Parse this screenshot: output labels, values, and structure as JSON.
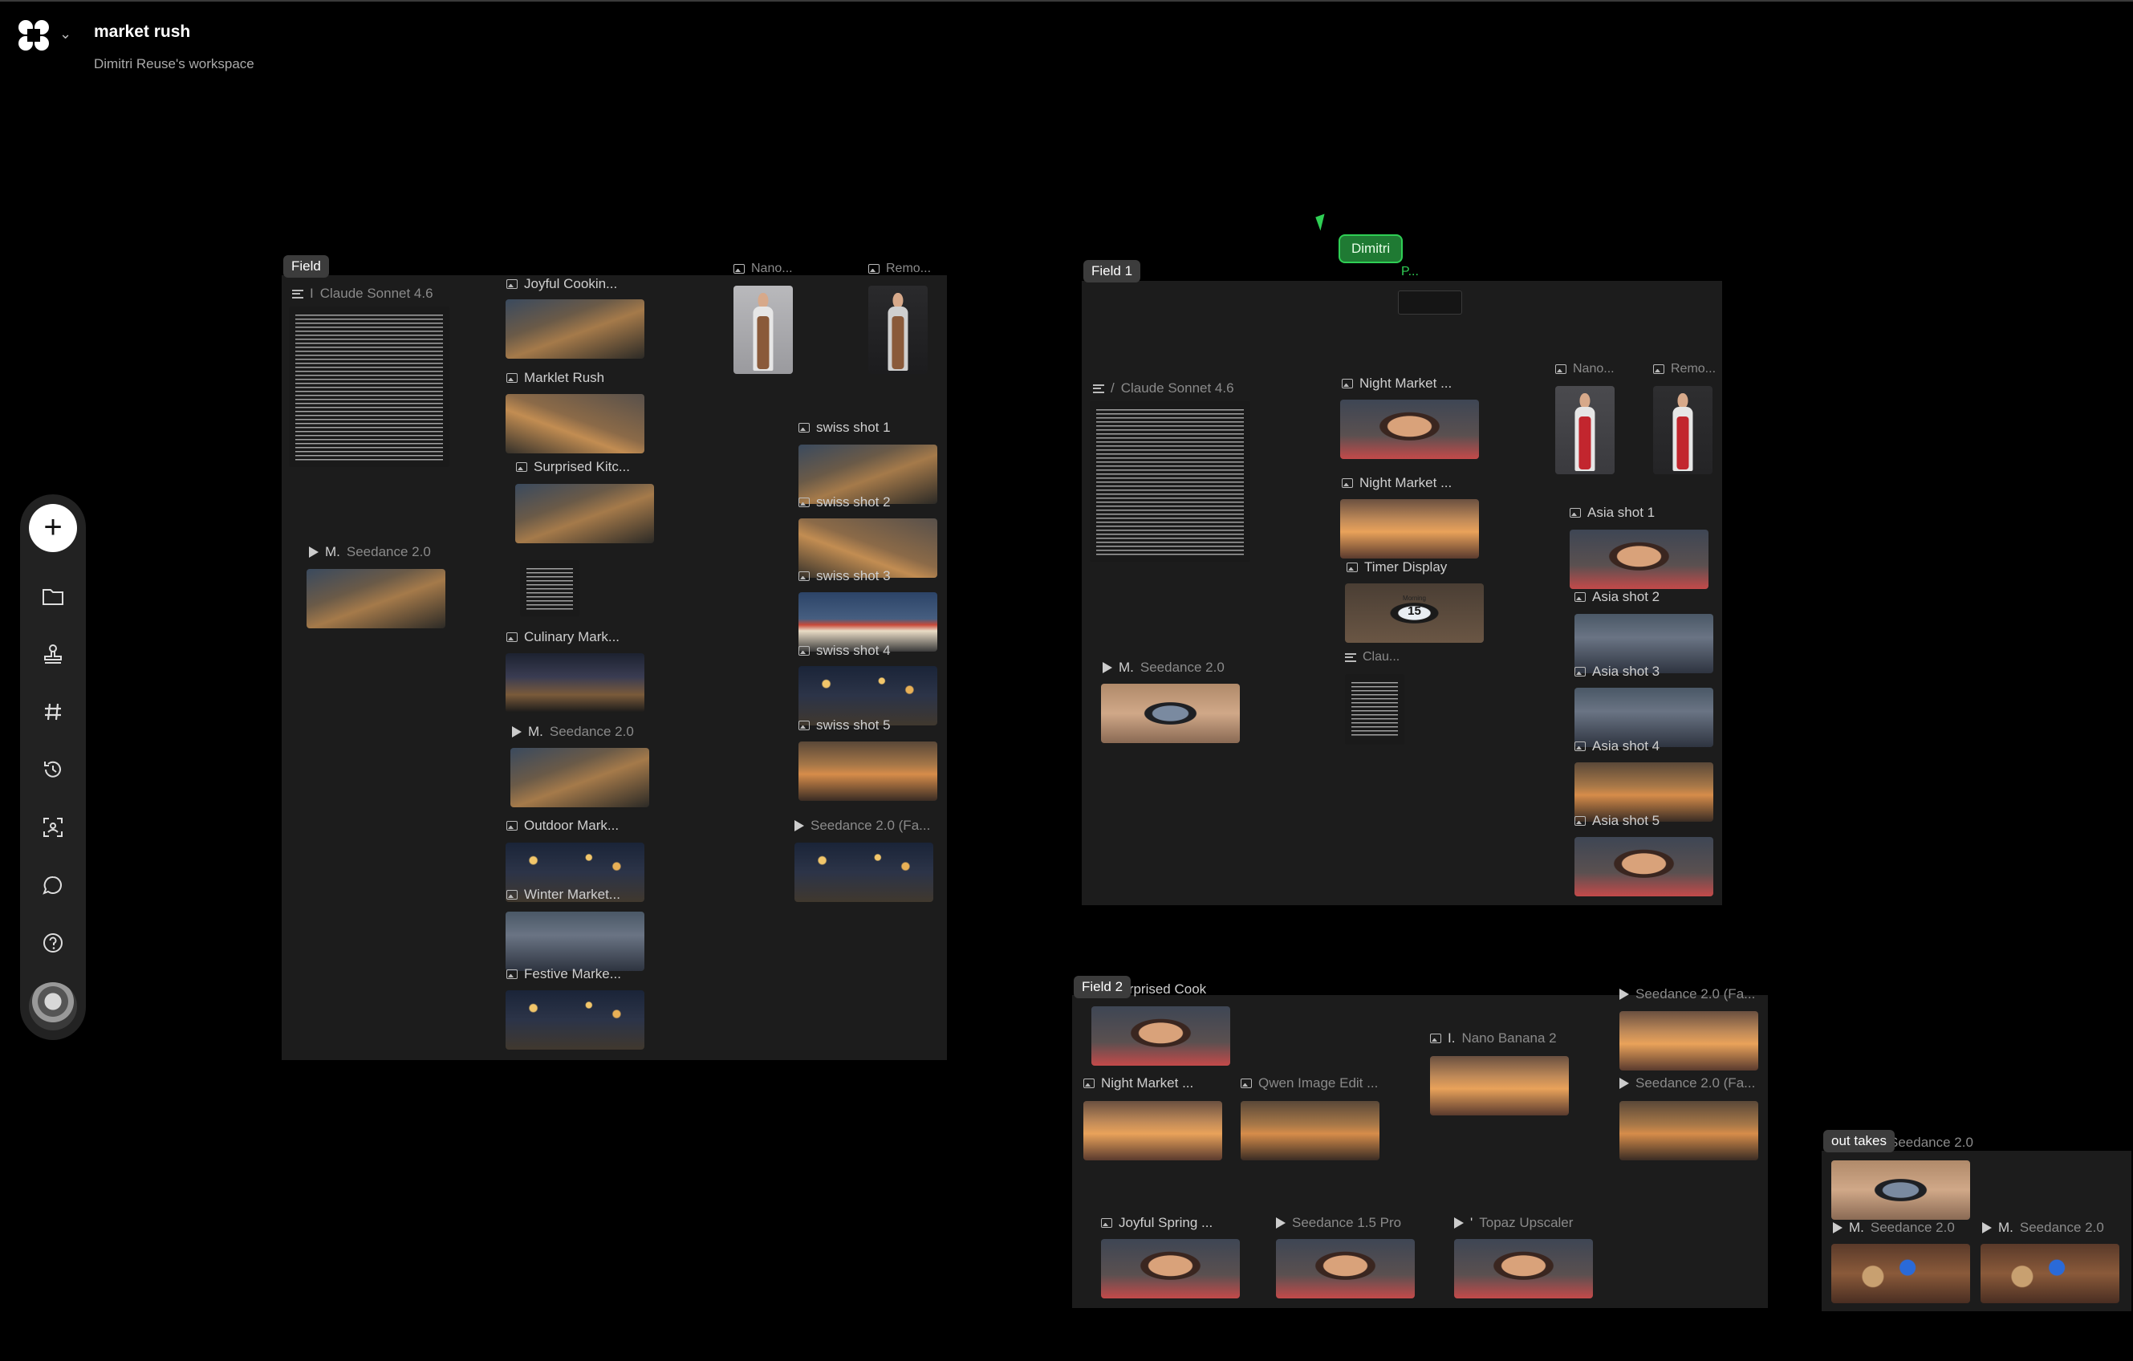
{
  "workspace": {
    "title": "market rush",
    "subtitle": "Dimitri Reuse's workspace"
  },
  "toolbar": {
    "items": [
      "add",
      "folder-icon",
      "stamp-icon",
      "hash-icon",
      "history-icon",
      "scan-icon",
      "chat-icon",
      "help-icon"
    ]
  },
  "collaborator": {
    "name": "Dimitri",
    "mini_label": "P..."
  },
  "field0": {
    "label": "Field",
    "nodes": {
      "claude": "Claude Sonnet 4.6",
      "claude_prefix": "I",
      "joyful": "Joyful Cookin...",
      "marklet": "Marklet Rush",
      "surprised": "Surprised Kitc...",
      "nano": "Nano...",
      "remo": "Remo...",
      "swiss1": "swiss shot 1",
      "swiss2": "swiss shot 2",
      "swiss3": "swiss shot 3",
      "swiss4": "swiss shot 4",
      "swiss5": "swiss shot 5",
      "seedance_a_prefix": "M.",
      "seedance_a": "Seedance 2.0",
      "culinary": "Culinary Mark...",
      "seedance_b_prefix": "M.",
      "seedance_b": "Seedance 2.0",
      "outdoor": "Outdoor Mark...",
      "seedance_fa": "Seedance 2.0 (Fa...",
      "winter": "Winter Market...",
      "festive": "Festive Marke..."
    }
  },
  "field1": {
    "label": "Field 1",
    "nodes": {
      "claude": "Claude Sonnet 4.6",
      "claude_prefix": "/",
      "night1": "Night Market ...",
      "night2": "Night Market ...",
      "timer": "Timer Display",
      "nano": "Nano...",
      "remo": "Remo...",
      "asia1": "Asia shot 1",
      "asia2": "Asia shot 2",
      "asia3": "Asia shot 3",
      "asia4": "Asia shot 4",
      "asia5": "Asia shot 5",
      "seedance_prefix": "M.",
      "seedance": "Seedance 2.0",
      "clau": "Clau..."
    }
  },
  "field2": {
    "label": "Field 2",
    "nodes": {
      "surprised": "Surprised Cook",
      "night": "Night Market ...",
      "qwen": "Qwen Image Edit ...",
      "nano_prefix": "I.",
      "nano": "Nano Banana 2",
      "seedance_fa1": "Seedance 2.0 (Fa...",
      "seedance_fa2": "Seedance 2.0 (Fa...",
      "joyful": "Joyful Spring ...",
      "seedance15": "Seedance 1.5 Pro",
      "topaz_prefix": "'",
      "topaz": "Topaz Upscaler"
    }
  },
  "outtakes": {
    "label": "out takes",
    "nodes": {
      "seedance_top": "Seedance 2.0",
      "seedance_a_prefix": "M.",
      "seedance_a": "Seedance 2.0",
      "seedance_b_prefix": "M.",
      "seedance_b": "Seedance 2.0"
    }
  },
  "phone_timer": {
    "line1": "Morning",
    "line2": "15"
  }
}
